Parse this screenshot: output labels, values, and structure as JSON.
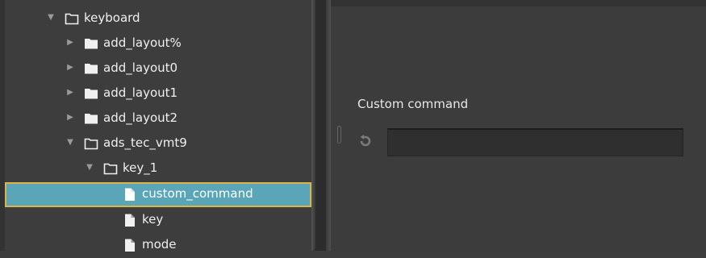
{
  "tree": {
    "items": [
      {
        "label": "keyboard",
        "expanded": true,
        "kind": "folder-open"
      },
      {
        "label": "add_layout%",
        "expanded": false,
        "kind": "folder"
      },
      {
        "label": "add_layout0",
        "expanded": false,
        "kind": "folder"
      },
      {
        "label": "add_layout1",
        "expanded": false,
        "kind": "folder"
      },
      {
        "label": "add_layout2",
        "expanded": false,
        "kind": "folder"
      },
      {
        "label": "ads_tec_vmt9",
        "expanded": true,
        "kind": "folder-open"
      },
      {
        "label": "key_1",
        "expanded": true,
        "kind": "folder-open"
      },
      {
        "label": "custom_command",
        "kind": "file",
        "selected": true
      },
      {
        "label": "key",
        "kind": "file"
      },
      {
        "label": "mode",
        "kind": "file"
      }
    ]
  },
  "detail": {
    "label": "Custom command",
    "value": "",
    "reset_icon": "reset-icon"
  },
  "colors": {
    "selection": "#5aa6b8",
    "selection_border": "#d8b64a",
    "background": "#3d3d3d"
  }
}
